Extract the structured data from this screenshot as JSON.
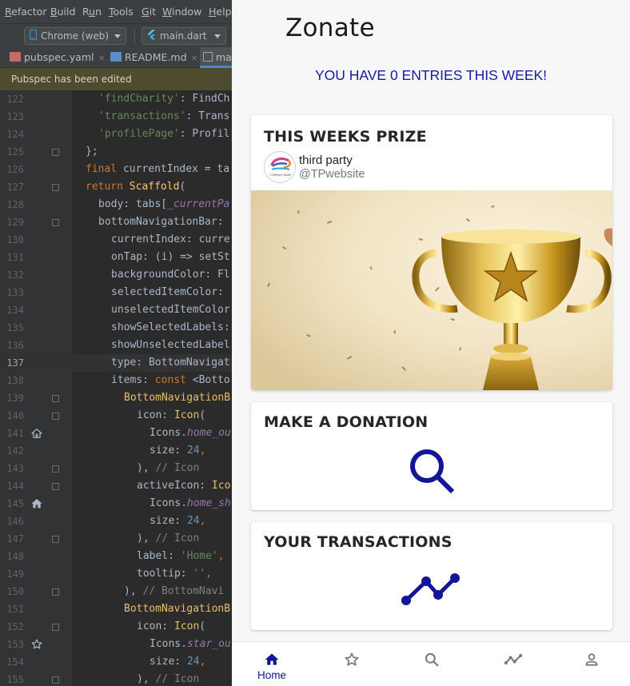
{
  "ide": {
    "menu": [
      {
        "label": "Refactor",
        "mnemonic": "R"
      },
      {
        "label": "Build",
        "mnemonic": "B"
      },
      {
        "label": "Run",
        "mnemonic": "u"
      },
      {
        "label": "Tools",
        "mnemonic": "T"
      },
      {
        "label": "Git",
        "mnemonic": "G"
      },
      {
        "label": "Window",
        "mnemonic": "W"
      },
      {
        "label": "Help",
        "mnemonic": "H"
      }
    ],
    "device_selector": "Chrome (web)",
    "run_config": "main.dart",
    "tabs": [
      {
        "label": "pubspec.yaml",
        "icon": "yaml-file-icon",
        "close": "×"
      },
      {
        "label": "README.md",
        "icon": "markdown-file-icon",
        "close": "×"
      },
      {
        "label": "ma",
        "icon": "dart-file-icon",
        "close": ""
      }
    ],
    "notification": "Pubspec has been edited",
    "lines": [
      {
        "n": "122",
        "code": [
          [
            "s",
            "'findCharity'"
          ],
          [
            "",
            ": "
          ],
          [
            "",
            "FindCh"
          ]
        ]
      },
      {
        "n": "123",
        "code": [
          [
            "s",
            "'transactions'"
          ],
          [
            "",
            ": "
          ],
          [
            "",
            "Trans"
          ]
        ]
      },
      {
        "n": "124",
        "code": [
          [
            "s",
            "'profilePage'"
          ],
          [
            "",
            ": "
          ],
          [
            "",
            "Profil"
          ]
        ]
      },
      {
        "n": "125",
        "code": [
          [
            "",
            "};"
          ]
        ]
      },
      {
        "n": "126",
        "code": [
          [
            "k",
            "final "
          ],
          [
            "",
            "currentIndex = ta"
          ]
        ]
      },
      {
        "n": "127",
        "code": [
          [
            "k",
            "return "
          ],
          [
            "cls",
            "Scaffold"
          ],
          [
            "",
            "("
          ]
        ]
      },
      {
        "n": "128",
        "code": [
          [
            "",
            "body: tabs["
          ],
          [
            "p",
            "_currentPa"
          ]
        ]
      },
      {
        "n": "129",
        "code": [
          [
            "",
            "bottomNavigationBar: "
          ]
        ]
      },
      {
        "n": "130",
        "code": [
          [
            "",
            "currentIndex: curre"
          ]
        ]
      },
      {
        "n": "131",
        "code": [
          [
            "",
            "onTap: (i) => setSt"
          ]
        ]
      },
      {
        "n": "132",
        "code": [
          [
            "",
            "backgroundColor: Fl"
          ]
        ]
      },
      {
        "n": "133",
        "code": [
          [
            "",
            "selectedItemColor: "
          ]
        ]
      },
      {
        "n": "134",
        "code": [
          [
            "",
            "unselectedItemColor"
          ]
        ]
      },
      {
        "n": "135",
        "code": [
          [
            "",
            "showSelectedLabels:"
          ]
        ]
      },
      {
        "n": "136",
        "code": [
          [
            "",
            "showUnselectedLabel"
          ]
        ]
      },
      {
        "n": "137",
        "code": [
          [
            "",
            "type: BottomNavigat"
          ]
        ]
      },
      {
        "n": "138",
        "code": [
          [
            "",
            "items: "
          ],
          [
            "k",
            "const "
          ],
          [
            "",
            "<Botto"
          ]
        ]
      },
      {
        "n": "139",
        "code": [
          [
            "cls2",
            "BottomNavigationB"
          ]
        ]
      },
      {
        "n": "140",
        "code": [
          [
            "",
            "icon: "
          ],
          [
            "cls2",
            "Icon"
          ],
          [
            "",
            "("
          ]
        ]
      },
      {
        "n": "141",
        "code": [
          [
            "",
            "Icons."
          ],
          [
            "p",
            "home_ou"
          ]
        ]
      },
      {
        "n": "142",
        "code": [
          [
            "",
            "size: "
          ],
          [
            "n",
            "24"
          ],
          [
            "k",
            ","
          ]
        ]
      },
      {
        "n": "143",
        "code": [
          [
            "",
            "), "
          ],
          [
            "c",
            " // Icon"
          ]
        ]
      },
      {
        "n": "144",
        "code": [
          [
            "",
            "activeIcon: "
          ],
          [
            "cls2",
            "Ico"
          ]
        ]
      },
      {
        "n": "145",
        "code": [
          [
            "",
            "Icons."
          ],
          [
            "p",
            "home_sh"
          ]
        ]
      },
      {
        "n": "146",
        "code": [
          [
            "",
            "size: "
          ],
          [
            "n",
            "24"
          ],
          [
            "k",
            ","
          ]
        ]
      },
      {
        "n": "147",
        "code": [
          [
            "",
            "), "
          ],
          [
            "c",
            " // Icon"
          ]
        ]
      },
      {
        "n": "148",
        "code": [
          [
            "",
            "label: "
          ],
          [
            "s",
            "'Home'"
          ],
          [
            "k",
            ","
          ]
        ]
      },
      {
        "n": "149",
        "code": [
          [
            "",
            "tooltip: "
          ],
          [
            "s",
            "''"
          ],
          [
            "k",
            ","
          ]
        ]
      },
      {
        "n": "150",
        "code": [
          [
            "",
            "), "
          ],
          [
            "c",
            " // BottomNavi"
          ]
        ]
      },
      {
        "n": "151",
        "code": [
          [
            "cls2",
            "BottomNavigationB"
          ]
        ]
      },
      {
        "n": "152",
        "code": [
          [
            "",
            "icon: "
          ],
          [
            "cls2",
            "Icon"
          ],
          [
            "",
            "("
          ]
        ]
      },
      {
        "n": "153",
        "code": [
          [
            "",
            "Icons."
          ],
          [
            "p",
            "star_ou"
          ]
        ]
      },
      {
        "n": "154",
        "code": [
          [
            "",
            "size: "
          ],
          [
            "n",
            "24"
          ],
          [
            "k",
            ","
          ]
        ]
      },
      {
        "n": "155",
        "code": [
          [
            "",
            "), "
          ],
          [
            "c",
            " // Icon"
          ]
        ]
      }
    ]
  },
  "app": {
    "title": "Zonate",
    "entries_banner": "YOU HAVE 0 ENTRIES THIS WEEK!",
    "prize_card": {
      "title": "THIS WEEKS PRIZE",
      "sponsor_name": "third party",
      "sponsor_handle": "@TPwebsite",
      "logo_text": "COMPANY NAME",
      "image": "gold-trophy-photo"
    },
    "donation_card": {
      "title": "MAKE A DONATION",
      "icon": "search-icon"
    },
    "transactions_card": {
      "title": "YOUR TRANSACTIONS",
      "icon": "trend-line-icon"
    },
    "bottom_nav": [
      {
        "label": "Home",
        "icon": "home-icon",
        "selected": true
      },
      {
        "label": "",
        "icon": "star-icon",
        "selected": false
      },
      {
        "label": "",
        "icon": "search-icon",
        "selected": false
      },
      {
        "label": "",
        "icon": "trend-icon",
        "selected": false
      },
      {
        "label": "",
        "icon": "person-icon",
        "selected": false
      }
    ],
    "colors": {
      "accent": "#14149a",
      "unselected": "#6e7b86",
      "background": "#f7f7f7"
    }
  }
}
